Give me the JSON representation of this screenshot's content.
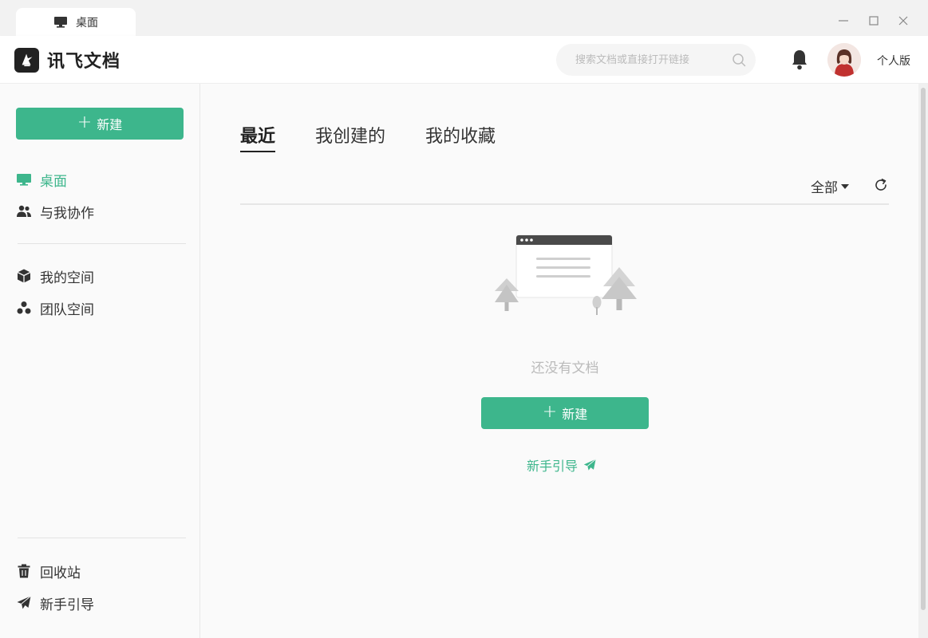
{
  "titlebar": {
    "tab_label": "桌面"
  },
  "header": {
    "app_name": "讯飞文档",
    "search_placeholder": "搜索文档或直接打开链接",
    "edition": "个人版"
  },
  "sidebar": {
    "new_button": "新建",
    "items": [
      {
        "label": "桌面",
        "icon": "monitor-icon",
        "active": true
      },
      {
        "label": "与我协作",
        "icon": "users-icon"
      },
      {
        "label": "我的空间",
        "icon": "cube-icon"
      },
      {
        "label": "团队空间",
        "icon": "team-icon"
      }
    ],
    "bottom_items": [
      {
        "label": "回收站",
        "icon": "trash-icon"
      },
      {
        "label": "新手引导",
        "icon": "paper-plane-icon"
      }
    ]
  },
  "main": {
    "tabs": [
      {
        "label": "最近",
        "active": true
      },
      {
        "label": "我创建的"
      },
      {
        "label": "我的收藏"
      }
    ],
    "filter_label": "全部",
    "empty_text": "还没有文档",
    "new_button": "新建",
    "guide_link": "新手引导"
  },
  "colors": {
    "accent": "#3db68c"
  }
}
